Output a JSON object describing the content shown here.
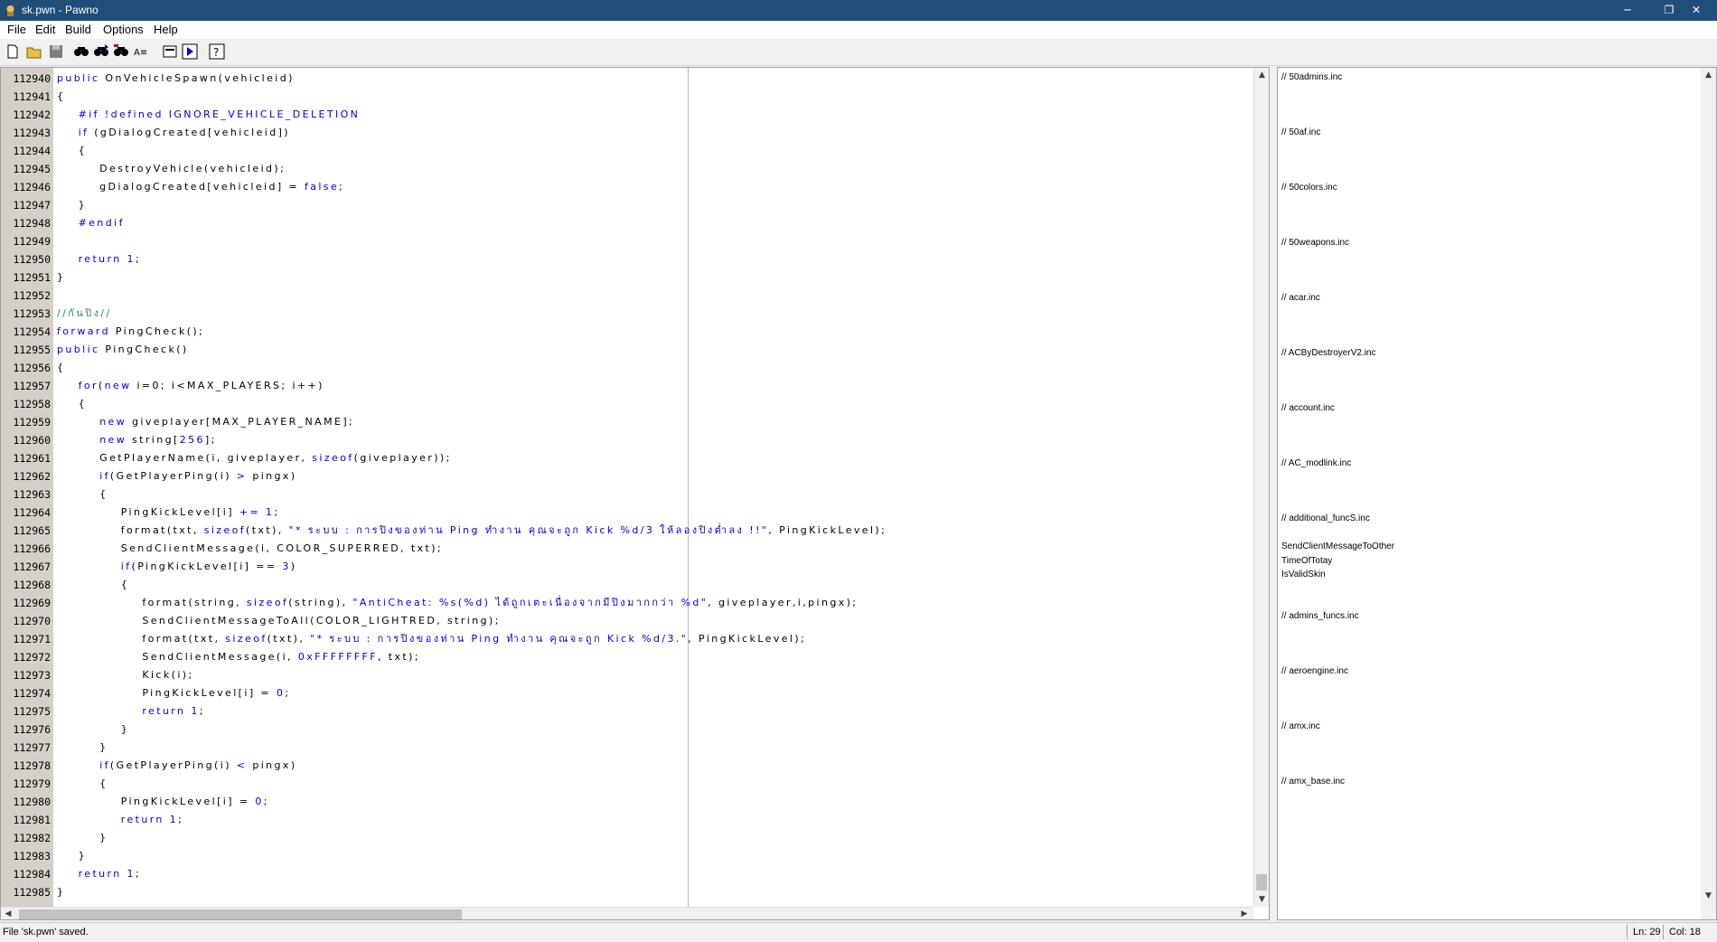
{
  "window": {
    "title": "sk.pwn - Pawno",
    "minimize": "─",
    "restore": "❐",
    "close": "✕"
  },
  "menu": [
    "File",
    "Edit",
    "Build",
    "Options",
    "Help"
  ],
  "toolbar": [
    "new-file-icon",
    "open-file-icon",
    "save-icon",
    "find-icon",
    "find-next-icon",
    "replace-icon",
    "go-to-line-icon",
    "function-list-icon",
    "compile-run-icon",
    "help-icon"
  ],
  "editor": {
    "line_numbers": [
      "112940",
      "112941",
      "112942",
      "112943",
      "112944",
      "112945",
      "112946",
      "112947",
      "112948",
      "112949",
      "112950",
      "112951",
      "112952",
      "112953",
      "112954",
      "112955",
      "112956",
      "112957",
      "112958",
      "112959",
      "112960",
      "112961",
      "112962",
      "112963",
      "112964",
      "112965",
      "112966",
      "112967",
      "112968",
      "112969",
      "112970",
      "112971",
      "112972",
      "112973",
      "112974",
      "112975",
      "112976",
      "112977",
      "112978",
      "112979",
      "112980",
      "112981",
      "112982",
      "112983",
      "112984",
      "112985"
    ],
    "lines": [
      [
        {
          "k": "kw",
          "t": "public"
        },
        {
          "t": " OnVehicleSpawn(vehicleid)"
        }
      ],
      [
        {
          "t": "{"
        }
      ],
      [
        {
          "t": "    "
        },
        {
          "k": "kw",
          "t": "#if !defined IGNORE_VEHICLE_DELETION"
        }
      ],
      [
        {
          "t": "    "
        },
        {
          "k": "kw",
          "t": "if"
        },
        {
          "t": " (gDialogCreated[vehicleid])"
        }
      ],
      [
        {
          "t": "    {"
        }
      ],
      [
        {
          "t": "        DestroyVehicle(vehicleid);"
        }
      ],
      [
        {
          "t": "        gDialogCreated[vehicleid] = "
        },
        {
          "k": "kw",
          "t": "false"
        },
        {
          "t": ";"
        }
      ],
      [
        {
          "t": "    }"
        }
      ],
      [
        {
          "t": "    "
        },
        {
          "k": "kw",
          "t": "#endif"
        }
      ],
      [
        {
          "t": ""
        }
      ],
      [
        {
          "t": "    "
        },
        {
          "k": "kw",
          "t": "return"
        },
        {
          "t": " "
        },
        {
          "k": "kw",
          "t": "1"
        },
        {
          "t": ";"
        }
      ],
      [
        {
          "t": "}"
        }
      ],
      [
        {
          "t": ""
        }
      ],
      [
        {
          "k": "cm",
          "t": "//กันปิง//"
        }
      ],
      [
        {
          "k": "kw",
          "t": "forward"
        },
        {
          "t": " PingCheck();"
        }
      ],
      [
        {
          "k": "kw",
          "t": "public"
        },
        {
          "t": " PingCheck()"
        }
      ],
      [
        {
          "t": "{"
        }
      ],
      [
        {
          "t": "    "
        },
        {
          "k": "kw",
          "t": "for"
        },
        {
          "t": "("
        },
        {
          "k": "kw",
          "t": "new"
        },
        {
          "t": " i=0; i<MAX_PLAYERS; i++)"
        }
      ],
      [
        {
          "t": "    {"
        }
      ],
      [
        {
          "t": "        "
        },
        {
          "k": "kw",
          "t": "new"
        },
        {
          "t": " giveplayer[MAX_PLAYER_NAME];"
        }
      ],
      [
        {
          "t": "        "
        },
        {
          "k": "kw",
          "t": "new"
        },
        {
          "t": " string["
        },
        {
          "k": "kw",
          "t": "256"
        },
        {
          "t": "];"
        }
      ],
      [
        {
          "t": "        GetPlayerName(i, giveplayer, "
        },
        {
          "k": "kw",
          "t": "sizeof"
        },
        {
          "t": "(giveplayer));"
        }
      ],
      [
        {
          "t": "        "
        },
        {
          "k": "kw",
          "t": "if"
        },
        {
          "t": "(GetPlayerPing(i) "
        },
        {
          "k": "kw",
          "t": ">"
        },
        {
          "t": " pingx)"
        }
      ],
      [
        {
          "t": "        {"
        }
      ],
      [
        {
          "t": "            PingKickLevel[i] "
        },
        {
          "k": "kw",
          "t": "+="
        },
        {
          "t": " "
        },
        {
          "k": "kw",
          "t": "1"
        },
        {
          "t": ";"
        }
      ],
      [
        {
          "t": "            format(txt, "
        },
        {
          "k": "kw",
          "t": "sizeof"
        },
        {
          "t": "(txt), "
        },
        {
          "k": "kw",
          "t": "\"* ระบบ : การปิงของท่าน Ping ทำงาน คุณจะถูก Kick %d/3 ให้ลองปิงต่ำลง !!\""
        },
        {
          "t": ", PingKickLevel);"
        }
      ],
      [
        {
          "t": "            SendClientMessage(i, COLOR_SUPERRED, txt);"
        }
      ],
      [
        {
          "t": "            "
        },
        {
          "k": "kw",
          "t": "if"
        },
        {
          "t": "(PingKickLevel[i] == "
        },
        {
          "k": "kw",
          "t": "3"
        },
        {
          "t": ")"
        }
      ],
      [
        {
          "t": "            {"
        }
      ],
      [
        {
          "t": "                format(string, "
        },
        {
          "k": "kw",
          "t": "sizeof"
        },
        {
          "t": "(string), "
        },
        {
          "k": "kw",
          "t": "\"AntiCheat: %s(%d) ได้ถูกเตะเนื่องจากมีปิงมากกว่า %d\""
        },
        {
          "t": ", giveplayer,i,pingx);"
        }
      ],
      [
        {
          "t": "                SendClientMessageToAll(COLOR_LIGHTRED, string);"
        }
      ],
      [
        {
          "t": "                format(txt, "
        },
        {
          "k": "kw",
          "t": "sizeof"
        },
        {
          "t": "(txt), "
        },
        {
          "k": "kw",
          "t": "\"* ระบบ : การปิงของท่าน Ping ทำงาน คุณจะถูก Kick %d/3.\""
        },
        {
          "t": ", PingKickLevel);"
        }
      ],
      [
        {
          "t": "                SendClientMessage(i, "
        },
        {
          "k": "kw",
          "t": "0xFFFFFFFF"
        },
        {
          "t": ", txt);"
        }
      ],
      [
        {
          "t": "                Kick(i);"
        }
      ],
      [
        {
          "t": "                PingKickLevel[i] = "
        },
        {
          "k": "kw",
          "t": "0"
        },
        {
          "t": ";"
        }
      ],
      [
        {
          "t": "                "
        },
        {
          "k": "kw",
          "t": "return"
        },
        {
          "t": " "
        },
        {
          "k": "kw",
          "t": "1"
        },
        {
          "t": ";"
        }
      ],
      [
        {
          "t": "            }"
        }
      ],
      [
        {
          "t": "        }"
        }
      ],
      [
        {
          "t": "        "
        },
        {
          "k": "kw",
          "t": "if"
        },
        {
          "t": "(GetPlayerPing(i) "
        },
        {
          "k": "kw",
          "t": "<"
        },
        {
          "t": " pingx)"
        }
      ],
      [
        {
          "t": "        {"
        }
      ],
      [
        {
          "t": "            PingKickLevel[i] = "
        },
        {
          "k": "kw",
          "t": "0"
        },
        {
          "t": ";"
        }
      ],
      [
        {
          "t": "            "
        },
        {
          "k": "kw",
          "t": "return"
        },
        {
          "t": " "
        },
        {
          "k": "kw",
          "t": "1"
        },
        {
          "t": ";"
        }
      ],
      [
        {
          "t": "        }"
        }
      ],
      [
        {
          "t": "    }"
        }
      ],
      [
        {
          "t": "    "
        },
        {
          "k": "kw",
          "t": "return"
        },
        {
          "t": " "
        },
        {
          "k": "kw",
          "t": "1"
        },
        {
          "t": ";"
        }
      ],
      [
        {
          "t": "}"
        }
      ]
    ]
  },
  "function_list": [
    "// 50admins.inc",
    "// 50af.inc",
    "// 50colors.inc",
    "// 50weapons.inc",
    "// acar.inc",
    "// ACByDestroyerV2.inc",
    "// account.inc",
    "// AC_modlink.inc",
    "// additional_funcS.inc",
    "SendClientMessageToOther",
    "TimeOfTotay",
    "IsValidSkin",
    "// admins_funcs.inc",
    "// aeroengine.inc",
    "// amx.inc",
    "// amx_base.inc"
  ],
  "status": {
    "message": "File 'sk.pwn' saved.",
    "line": "Ln: 29",
    "col": "Col: 18"
  },
  "colors": {
    "titlebar": "#1f4e79",
    "keyword": "#0000e0",
    "comment": "#2e8b57",
    "gutter": "#d4d0c8"
  }
}
